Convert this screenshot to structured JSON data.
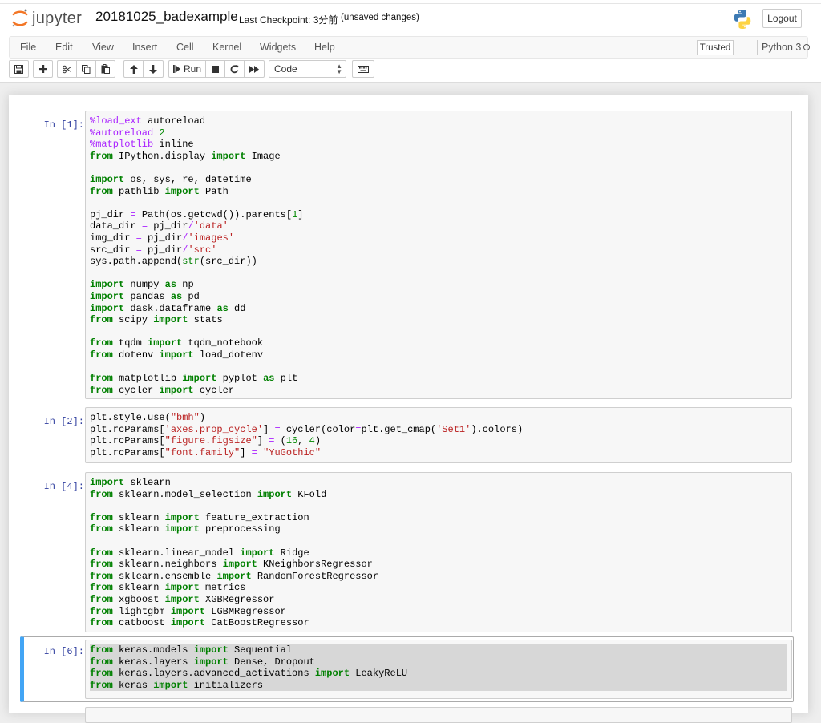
{
  "header": {
    "logo_text": "jupyter",
    "notebook_name": "20181025_badexample",
    "checkpoint": "Last Checkpoint: 3分前",
    "unsaved": "(unsaved changes)",
    "logout_label": "Logout"
  },
  "menu": {
    "items": [
      "File",
      "Edit",
      "View",
      "Insert",
      "Cell",
      "Kernel",
      "Widgets",
      "Help"
    ],
    "trusted_label": "Trusted",
    "kernel_name": "Python 3"
  },
  "toolbar": {
    "run_label": "Run",
    "cell_type": "Code"
  },
  "cells": [
    {
      "prompt": "In [1]:",
      "lines": [
        "%load_ext autoreload",
        "%autoreload 2",
        "%matplotlib inline",
        "from IPython.display import Image",
        "",
        "import os, sys, re, datetime",
        "from pathlib import Path",
        "",
        "pj_dir = Path(os.getcwd()).parents[1]",
        "data_dir = pj_dir/'data'",
        "img_dir = pj_dir/'images'",
        "src_dir = pj_dir/'src'",
        "sys.path.append(str(src_dir))",
        "",
        "import numpy as np",
        "import pandas as pd",
        "import dask.dataframe as dd",
        "from scipy import stats",
        "",
        "from tqdm import tqdm_notebook",
        "from dotenv import load_dotenv",
        "",
        "from matplotlib import pyplot as plt",
        "from cycler import cycler"
      ]
    },
    {
      "prompt": "In [2]:",
      "lines": [
        "plt.style.use(\"bmh\")",
        "plt.rcParams['axes.prop_cycle'] = cycler(color=plt.get_cmap('Set1').colors)",
        "plt.rcParams[\"figure.figsize\"] = (16, 4)",
        "plt.rcParams[\"font.family\"] = \"YuGothic\""
      ]
    },
    {
      "prompt": "In [4]:",
      "lines": [
        "import sklearn",
        "from sklearn.model_selection import KFold",
        "",
        "from sklearn import feature_extraction",
        "from sklearn import preprocessing",
        "",
        "from sklearn.linear_model import Ridge",
        "from sklearn.neighbors import KNeighborsRegressor",
        "from sklearn.ensemble import RandomForestRegressor",
        "from sklearn import metrics",
        "from xgboost import XGBRegressor",
        "from lightgbm import LGBMRegressor",
        "from catboost import CatBoostRegressor"
      ]
    },
    {
      "prompt": "In [6]:",
      "selected": true,
      "lines": [
        "from keras.models import Sequential",
        "from keras.layers import Dense, Dropout",
        "from keras.layers.advanced_activations import LeakyReLU",
        "from keras import initializers"
      ]
    }
  ],
  "colors": {
    "prompt": "#303f9f",
    "keyword": "#008000",
    "string": "#ba2121",
    "magic": "#aa22ff",
    "selected_border": "#42a5f5",
    "logo_orange": "#f37626"
  }
}
